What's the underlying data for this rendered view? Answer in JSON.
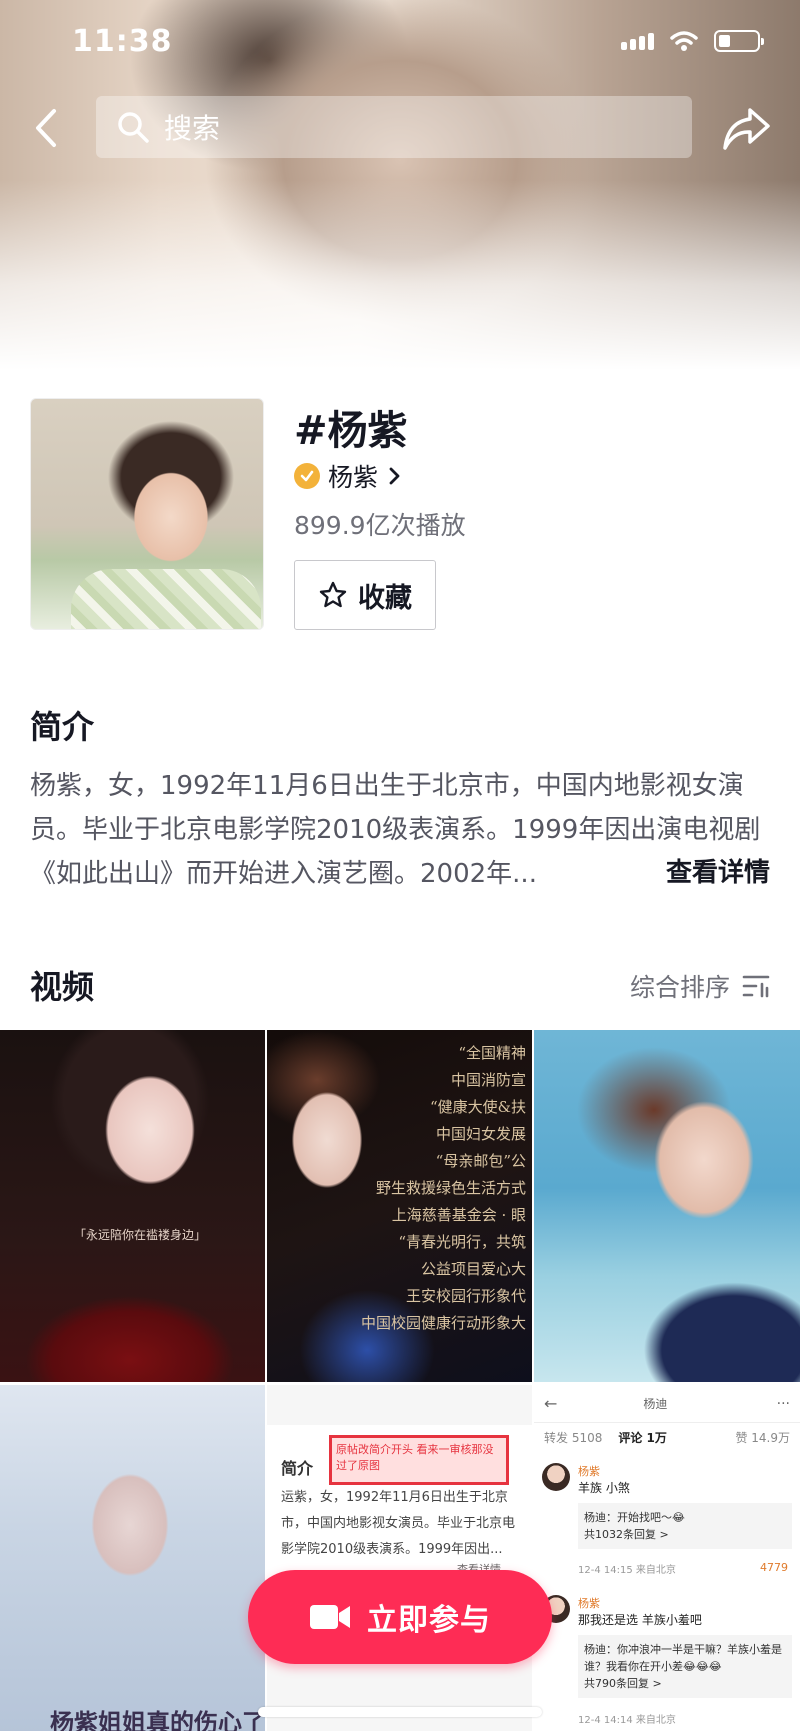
{
  "status_bar": {
    "time": "11:38",
    "battery_level": 0.3
  },
  "search": {
    "placeholder": "搜索"
  },
  "topic": {
    "title": "#杨紫",
    "owner": "杨紫",
    "plays": "899.9亿次播放",
    "favorite_label": "收藏"
  },
  "intro": {
    "title": "简介",
    "text": "杨紫，女，1992年11月6日出生于北京市，中国内地影视女演员。毕业于北京电影学院2010级表演系。1999年因出演电视剧《如此出山》而开始进入演艺圈。2002年...",
    "more_label": "查看详情"
  },
  "videos": {
    "title": "视频",
    "sort_label": "综合排序",
    "tiles": [
      {
        "caption": "「永远陪你在褴褛身边」"
      },
      {
        "lines": [
          "“全国精神",
          "中国消防宣",
          "“健康大使&扶",
          "中国妇女发展",
          "“母亲邮包”公",
          "野生救援绿色生活方式",
          "上海慈善基金会 · 眼",
          "“青春光明行，共筑",
          "公益项目爱心大",
          "王安校园行形象代",
          "中国校园健康行动形象大"
        ]
      },
      {
        "caption": "杨紫姐姐真的伤心了"
      },
      {
        "doc_title": "简介",
        "doc_text": "运紫，女，1992年11月6日出生于北京市，中国内地影视女演员。毕业于北京电影学院2010级表演系。1999年因出...",
        "doc_more": "查看详情",
        "note": "原帖改简介开头 看来一审核那没过了原图"
      },
      {
        "header_name": "杨迪",
        "reposts": "转发 5108",
        "comments": "评论 1万",
        "likes": "赞 14.9万",
        "items": [
          {
            "name": "杨紫",
            "body": "羊族 小煞",
            "reply": "杨迪：开始找吧～😂",
            "reply_count": "共1032条回复 >",
            "meta": "12-4 14:15 来自北京",
            "like": "4779"
          },
          {
            "name": "杨紫",
            "body": "那我还是选 羊族小羞吧",
            "reply": "杨迪：你冲浪冲一半是干嘛？羊族小羞是谁？我看你在开小差😂😂😂",
            "reply_count": "共790条回复 >",
            "meta": "12-4 14:14 来自北京",
            "like": ""
          }
        ]
      }
    ]
  },
  "join_button": {
    "label": "立即参与"
  },
  "colors": {
    "accent": "#fe2c55",
    "verified": "#f3b23a"
  }
}
